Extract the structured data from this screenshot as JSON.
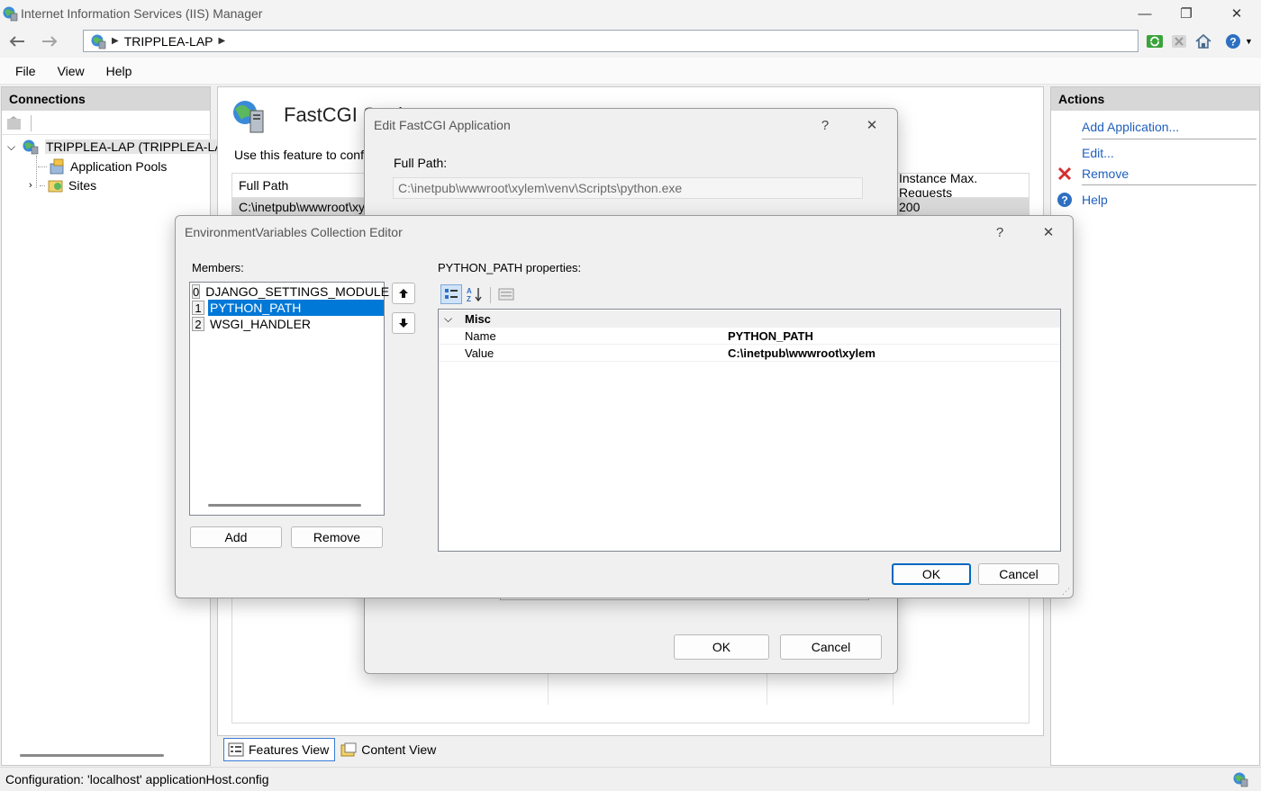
{
  "window": {
    "title": "Internet Information Services (IIS) Manager",
    "controls": {
      "minimize": "—",
      "restore": "❐",
      "close": "✕"
    }
  },
  "address": {
    "crumb": "TRIPPLEA-LAP"
  },
  "menu": {
    "items": [
      "File",
      "View",
      "Help"
    ]
  },
  "connections": {
    "header": "Connections",
    "tree": {
      "server": "TRIPPLEA-LAP (TRIPPLEA-LAP",
      "app_pools": "Application Pools",
      "sites": "Sites"
    }
  },
  "feature": {
    "title": "FastCGI Settings",
    "description": "Use this feature to configure",
    "columns": {
      "full_path": "Full Path",
      "instance_max": "Instance Max. Requests"
    },
    "row": {
      "full_path": "C:\\inetpub\\wwwroot\\xylem\\venv\\Scripts\\python.exe",
      "instance_max": "200"
    }
  },
  "view_tabs": {
    "features": "Features View",
    "content": "Content View"
  },
  "actions": {
    "header": "Actions",
    "add": "Add Application...",
    "edit": "Edit...",
    "remove": "Remove",
    "help": "Help"
  },
  "status": {
    "text": "Configuration: 'localhost' applicationHost.config"
  },
  "fastcgi_dialog": {
    "title": "Edit FastCGI Application",
    "help_glyph": "?",
    "close_glyph": "✕",
    "full_path_label": "Full Path:",
    "full_path_value": "C:\\inetpub\\wwwroot\\xylem\\venv\\Scripts\\python.exe",
    "ok": "OK",
    "cancel": "Cancel"
  },
  "env_dialog": {
    "title": "EnvironmentVariables Collection Editor",
    "help_glyph": "?",
    "close_glyph": "✕",
    "members_label": "Members:",
    "members": [
      {
        "index": "0",
        "name": "DJANGO_SETTINGS_MODULE"
      },
      {
        "index": "1",
        "name": "PYTHON_PATH"
      },
      {
        "index": "2",
        "name": "WSGI_HANDLER"
      }
    ],
    "selected_index": 1,
    "up_glyph": "🡅",
    "down_glyph": "🡇",
    "add": "Add",
    "remove": "Remove",
    "properties_label": "PYTHON_PATH properties:",
    "category": "Misc",
    "properties": [
      {
        "name": "Name",
        "value": "PYTHON_PATH"
      },
      {
        "name": "Value",
        "value": "C:\\inetpub\\wwwroot\\xylem"
      }
    ],
    "ok": "OK",
    "cancel": "Cancel"
  },
  "colors": {
    "accent": "#0078d7",
    "link": "#1f5fbf",
    "remove": "#d32f2f"
  }
}
